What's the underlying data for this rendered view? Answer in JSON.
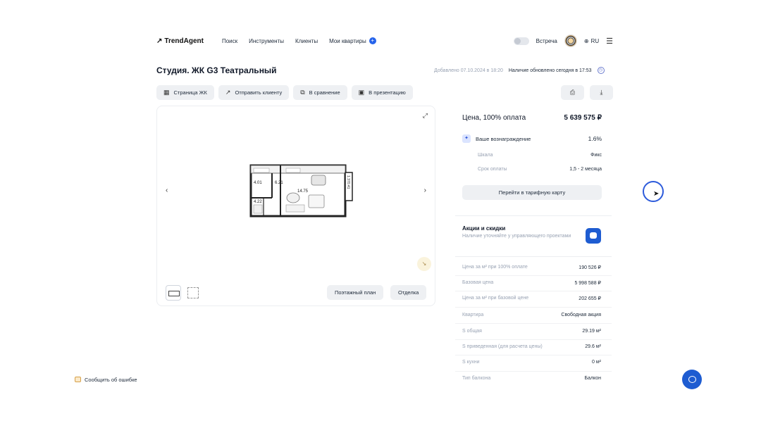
{
  "header": {
    "logo": "TrendAgent",
    "nav": [
      "Поиск",
      "Инструменты",
      "Клиенты",
      "Мои квартиры"
    ],
    "meeting_label": "Встреча",
    "language": "RU"
  },
  "page": {
    "title": "Студия. ЖК G3 Театральный",
    "added": "Добавлено 07.10.2024 в 18:20",
    "updated": "Наличие обновлено сегодня в 17:53"
  },
  "toolbar": {
    "buttons": [
      "Страница ЖК",
      "Отправить клиенту",
      "В сравнение",
      "В презентацию"
    ],
    "print_icon": "printer-icon",
    "download_icon": "download-icon"
  },
  "plan": {
    "rooms": [
      "4.01",
      "6.21",
      "14.75",
      "4.22",
      "1.370.41"
    ],
    "floor_plan_button": "Поэтажный план",
    "finishing_button": "Отделка"
  },
  "price": {
    "label": "Цена, 100% оплата",
    "value": "5 639 575 ₽",
    "reward_label": "Ваше вознаграждение",
    "reward_value": "1.6%",
    "scale_label": "Шкала",
    "scale_value": "Фикс",
    "term_label": "Срок оплаты",
    "term_value": "1,5 - 2 месяца",
    "tariff_button": "Перейти в тарифную карту"
  },
  "promo": {
    "title": "Акции и скидки",
    "text": "Наличие уточняйте у управляющего проектами"
  },
  "properties": [
    {
      "label": "Цена за м² при 100% оплате",
      "value": "190 526 ₽"
    },
    {
      "label": "Базовая цена",
      "value": "5 998 588 ₽"
    },
    {
      "label": "Цена за м² при базовой цене",
      "value": "202 655 ₽"
    },
    {
      "label": "Квартира",
      "value": "Свободная акция"
    },
    {
      "label": "S общая",
      "value": "29.19 м²"
    },
    {
      "label": "S приведенная (для расчета цены)",
      "value": "29.6 м²"
    },
    {
      "label": "S кухни",
      "value": "0 м²"
    },
    {
      "label": "Тип балкона",
      "value": "Балкон"
    }
  ],
  "footer": {
    "report_error": "Сообщить об ошибке"
  },
  "colors": {
    "accent": "#1e5cd1",
    "button_bg": "#eef0f3",
    "muted_text": "#98a2b3"
  }
}
